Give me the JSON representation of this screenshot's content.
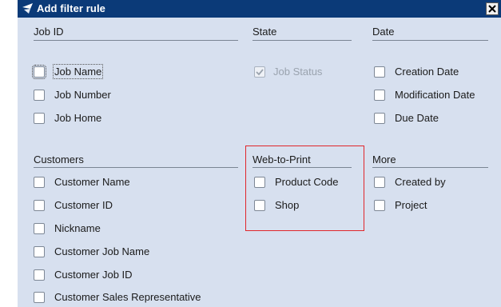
{
  "dialog": {
    "title": "Add filter rule",
    "close_icon": "close-icon",
    "title_icon": "funnel-icon"
  },
  "sections": {
    "job_id": {
      "title": "Job ID",
      "items": [
        {
          "label": "Job Name",
          "checked": false
        },
        {
          "label": "Job Number",
          "checked": false
        },
        {
          "label": "Job Home",
          "checked": false
        }
      ]
    },
    "state": {
      "title": "State",
      "items": [
        {
          "label": "Job Status",
          "checked": true,
          "disabled": true
        }
      ]
    },
    "date": {
      "title": "Date",
      "items": [
        {
          "label": "Creation Date",
          "checked": false
        },
        {
          "label": "Modification Date",
          "checked": false
        },
        {
          "label": "Due Date",
          "checked": false
        }
      ]
    },
    "customers": {
      "title": "Customers",
      "items": [
        {
          "label": "Customer Name",
          "checked": false
        },
        {
          "label": "Customer ID",
          "checked": false
        },
        {
          "label": "Nickname",
          "checked": false
        },
        {
          "label": "Customer Job Name",
          "checked": false
        },
        {
          "label": "Customer Job ID",
          "checked": false
        },
        {
          "label": "Customer Sales Representative",
          "checked": false
        }
      ]
    },
    "web_to_print": {
      "title": "Web-to-Print",
      "items": [
        {
          "label": "Product Code",
          "checked": false
        },
        {
          "label": "Shop",
          "checked": false
        }
      ]
    },
    "more": {
      "title": "More",
      "items": [
        {
          "label": "Created by",
          "checked": false
        },
        {
          "label": "Project",
          "checked": false
        }
      ]
    }
  },
  "colors": {
    "titlebar": "#0b3a78",
    "dialog_bg": "#d7e0ef",
    "highlight": "#e0262b",
    "disabled_text": "#9aa3ae"
  }
}
